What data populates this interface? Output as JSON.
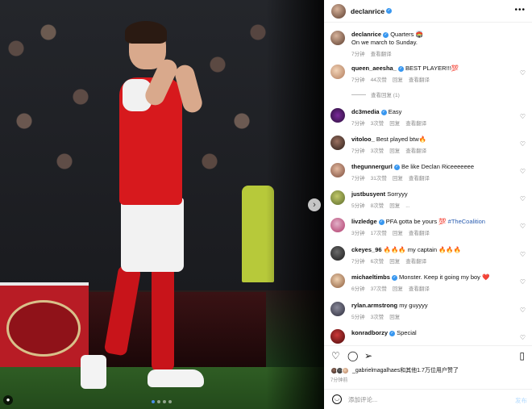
{
  "post": {
    "username": "declanrice",
    "caption_user": "declanrice",
    "caption_text": "Quarters 🏟️",
    "caption_line2": "On we march to Sunday.",
    "caption_time": "7分钟",
    "caption_translate": "查看翻译"
  },
  "comments": [
    {
      "user": "queen_aeesha_",
      "verified": true,
      "text": "BEST PLAYER!!!💯",
      "time": "7分钟",
      "likes": "44次赞",
      "reply": "回复",
      "translate": "查看翻译",
      "view_replies": "查看回复 (1)"
    },
    {
      "user": "dc3media",
      "verified": true,
      "text": "Easy",
      "time": "7分钟",
      "likes": "3次赞",
      "reply": "回复",
      "translate": "查看翻译"
    },
    {
      "user": "vitoloo_",
      "verified": false,
      "text": "Best played btw🔥",
      "time": "7分钟",
      "likes": "3次赞",
      "reply": "回复",
      "translate": "查看翻译"
    },
    {
      "user": "thegunnergurl",
      "verified": true,
      "text": "Be like Declan Riceeeeeee",
      "time": "7分钟",
      "likes": "31次赞",
      "reply": "回复",
      "translate": "查看翻译"
    },
    {
      "user": "justbusyent",
      "verified": false,
      "text": "Sorryyy",
      "time": "5分钟",
      "likes": "8次赞",
      "reply": "回复",
      "translate": "..."
    },
    {
      "user": "livzledge",
      "verified": true,
      "text": "PFA gotta be yours 💯",
      "hashtag": "#TheCoalition",
      "time": "3分钟",
      "likes": "17次赞",
      "reply": "回复",
      "translate": "查看翻译"
    },
    {
      "user": "ckeyes_96",
      "verified": false,
      "text": "🔥🔥🔥 my captain 🔥🔥🔥",
      "time": "7分钟",
      "likes": "6次赞",
      "reply": "回复",
      "translate": "查看翻译"
    },
    {
      "user": "michaeltimbs",
      "verified": true,
      "text": "Monster. Keep it going my boy ❤️",
      "time": "6分钟",
      "likes": "37次赞",
      "reply": "回复",
      "translate": "查看翻译"
    },
    {
      "user": "rylan.armstrong",
      "verified": false,
      "text": "my guyyyy",
      "time": "5分钟",
      "likes": "3次赞",
      "reply": "回复",
      "translate": ""
    },
    {
      "user": "konradborzy",
      "verified": true,
      "text": "Special",
      "time": "",
      "likes": "",
      "reply": "",
      "translate": ""
    }
  ],
  "footer": {
    "likes_text": "_gabrielmagalhaes和其他1.7万位用户赞了",
    "time_ago": "7分钟前",
    "comment_placeholder": "添加评论...",
    "post_label": "发布"
  },
  "icons": {
    "heart": "heart-icon",
    "comment": "comment-icon",
    "share": "share-icon",
    "save": "bookmark-icon",
    "emoji": "emoji-icon",
    "next": "chevron-right-icon",
    "more": "more-icon"
  },
  "colors": {
    "accent": "#3897f0",
    "hashtag": "#2a5db0",
    "muted": "#8e8e8e",
    "post_button": "#b3dbff"
  },
  "carousel": {
    "current_slide": 1,
    "slide_count": 4
  }
}
